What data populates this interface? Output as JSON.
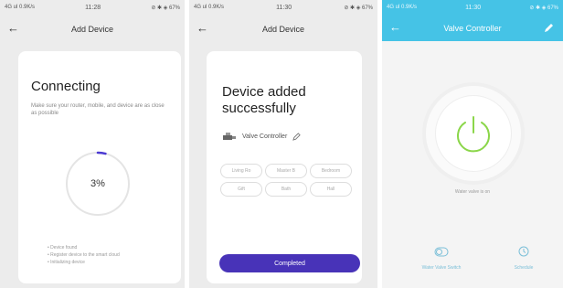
{
  "screen1": {
    "status": {
      "carrier": "4G ul 0.9K/s",
      "time": "11:28",
      "battery": "⊘ ✱ ◈ 67%"
    },
    "title": "Add Device",
    "heading": "Connecting",
    "subtitle": "Make sure your router, mobile, and device are as close as possible",
    "progress_text": "3%",
    "progress": 0.03,
    "steps": [
      "Device found",
      "Register device to the smart cloud",
      "Initializing device"
    ]
  },
  "screen2": {
    "status": {
      "carrier": "4G ul 0.9K/s",
      "time": "11:30",
      "battery": "⊘ ✱ ◈ 67%"
    },
    "title": "Add Device",
    "heading_line1": "Device added",
    "heading_line2": "successfully",
    "device_name": "Valve Controller",
    "rooms_row1": [
      "Living Ro",
      "Master B",
      "Bedroom"
    ],
    "rooms_row2": [
      "Gift",
      "Bath",
      "Hall"
    ],
    "complete_label": "Completed"
  },
  "screen3": {
    "status": {
      "carrier": "4G ul 0.9K/s",
      "time": "11:30",
      "battery": "⊘ ✱ ◈ 67%"
    },
    "title": "Valve Controller",
    "valve_status": "Water valve is on",
    "btn_left": "Water Valve Switch",
    "btn_right": "Schedule",
    "colors": {
      "accent": "#45c3e6",
      "power": "#8bd64a",
      "primary_button": "#4833b8"
    }
  }
}
